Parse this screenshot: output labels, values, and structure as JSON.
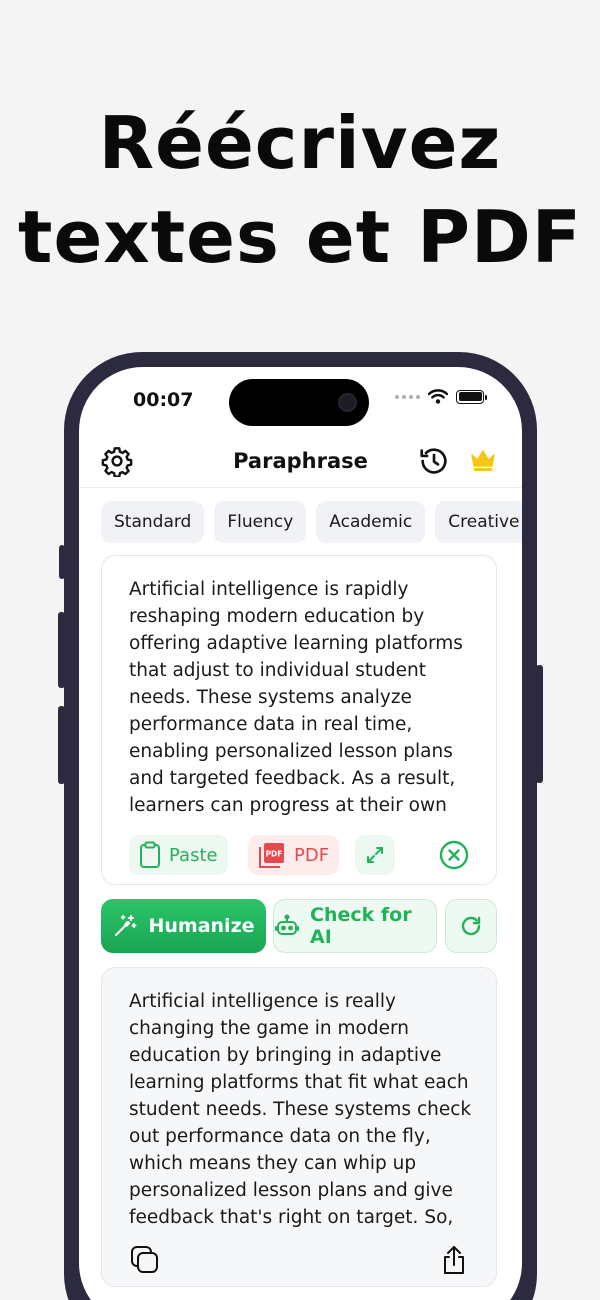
{
  "promo": {
    "headline_line1": "Réécrivez",
    "headline_line2": "textes et PDF"
  },
  "status_bar": {
    "time": "00:07",
    "icons": [
      "signal-dots-icon",
      "wifi-icon",
      "battery-icon"
    ]
  },
  "nav": {
    "title": "Paraphrase",
    "left_icon": "gear-icon",
    "right_icons": [
      "history-icon",
      "crown-icon"
    ]
  },
  "modes": [
    "Standard",
    "Fluency",
    "Academic",
    "Creative"
  ],
  "input": {
    "text": "Artificial intelligence is rapidly reshaping modern education by offering adaptive learning platforms that adjust to individual student needs. These systems analyze performance data in real time, enabling personalized lesson plans and targeted feedback. As a result, learners can progress at their own",
    "paste_label": "Paste",
    "pdf_label": "PDF",
    "pdf_badge": "PDF"
  },
  "actions": {
    "humanize_label": "Humanize",
    "check_ai_label": "Check for AI"
  },
  "output": {
    "text": "Artificial intelligence is really changing the game in modern education by bringing in adaptive learning platforms that fit what each student needs. These systems check out performance data on the fly, which means they can whip up personalized lesson plans and give feedback that's right on target. So,"
  },
  "colors": {
    "accent_green": "#22b35a",
    "pdf_red": "#e5484d",
    "crown_gold": "#f5c518",
    "phone_frame": "#2c2a3f"
  }
}
